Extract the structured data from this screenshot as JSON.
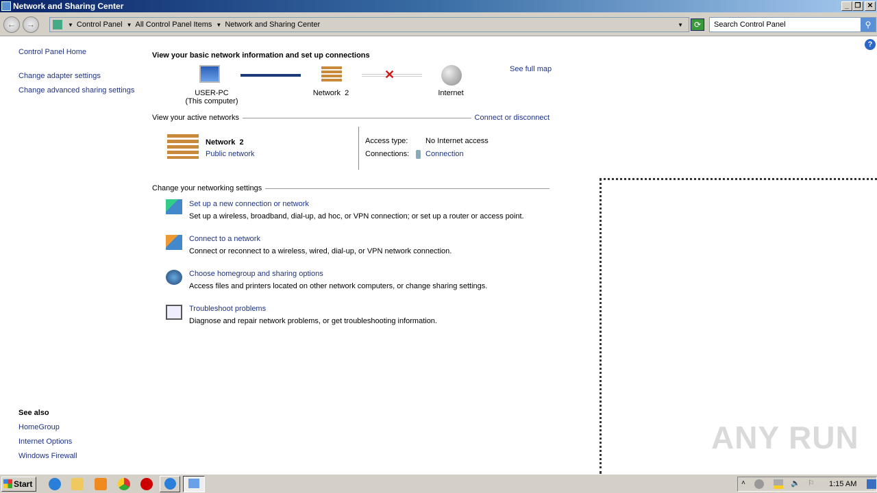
{
  "window": {
    "title": "Network and Sharing Center",
    "controls": [
      "minimize",
      "restore",
      "close"
    ]
  },
  "address": {
    "breadcrumbs": [
      "Control Panel",
      "All Control Panel Items",
      "Network and Sharing Center"
    ],
    "search_placeholder": "Search Control Panel"
  },
  "sidebar": {
    "home": "Control Panel Home",
    "links": [
      "Change adapter settings",
      "Change advanced sharing settings"
    ],
    "see_also_title": "See also",
    "see_also": [
      "HomeGroup",
      "Internet Options",
      "Windows Firewall"
    ]
  },
  "main": {
    "heading": "View your basic network information and set up connections",
    "map": {
      "computer": "USER-PC",
      "computer_sub": "(This computer)",
      "network": "Network  2",
      "internet": "Internet",
      "see_full_map": "See full map",
      "internet_status": "disconnected"
    },
    "active": {
      "section": "View your active networks",
      "connect_link": "Connect or disconnect",
      "name": "Network  2",
      "category": "Public network",
      "access_label": "Access type:",
      "access_value": "No Internet access",
      "connections_label": "Connections:",
      "connections_value": "Connection"
    },
    "settings": {
      "section": "Change your networking settings",
      "tasks": [
        {
          "title": "Set up a new connection or network",
          "desc": "Set up a wireless, broadband, dial-up, ad hoc, or VPN connection; or set up a router or access point.",
          "icon": "new-connection-icon"
        },
        {
          "title": "Connect to a network",
          "desc": "Connect or reconnect to a wireless, wired, dial-up, or VPN network connection.",
          "icon": "connect-network-icon"
        },
        {
          "title": "Choose homegroup and sharing options",
          "desc": "Access files and printers located on other network computers, or change sharing settings.",
          "icon": "homegroup-icon"
        },
        {
          "title": "Troubleshoot problems",
          "desc": "Diagnose and repair network problems, or get troubleshooting information.",
          "icon": "troubleshoot-icon"
        }
      ]
    }
  },
  "taskbar": {
    "start": "Start",
    "clock": "1:15 AM",
    "apps": [
      "internet-explorer",
      "explorer",
      "media-player",
      "chrome",
      "opera",
      "network-app",
      "control-panel"
    ]
  },
  "watermark": "ANY RUN"
}
